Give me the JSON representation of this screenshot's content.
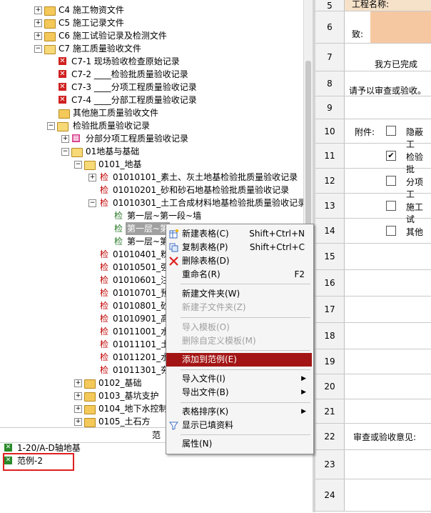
{
  "tree": [
    {
      "text": "C4 施工物资文件"
    },
    {
      "text": "C5 施工记录文件"
    },
    {
      "text": "C6 施工试验记录及检测文件"
    },
    {
      "text": "C7 施工质量验收文件"
    },
    {
      "text": "C7-1 现场验收检查原始记录"
    },
    {
      "text": "C7-2 ____检验批质量验收记录"
    },
    {
      "text": "C7-3 ____分项工程质量验收记录"
    },
    {
      "text": "C7-4 ____分部工程质量验收记录"
    },
    {
      "text": "其他施工质量验收文件"
    },
    {
      "text": "检验批质量验收记录"
    },
    {
      "text": "分部分项工程质量验收记录"
    },
    {
      "text": "01地基与基础"
    },
    {
      "text": "0101_地基"
    },
    {
      "text": "01010101_素土、灰土地基检验批质量验收记录"
    },
    {
      "text": "01010201_砂和砂石地基检验批质量验收记录"
    },
    {
      "text": "01010301_土工合成材料地基检验批质量验收记录"
    },
    {
      "text": "第一层~第一段~墙"
    },
    {
      "text": "第一层~第"
    },
    {
      "text": "第一层~第"
    },
    {
      "text": "01010401_粉煤"
    },
    {
      "text": "01010501_强夯"
    },
    {
      "text": "01010601_注浆"
    },
    {
      "text": "01010701_预压"
    },
    {
      "text": "01010801_砂石"
    },
    {
      "text": "01010901_高压"
    },
    {
      "text": "01011001_水泥"
    },
    {
      "text": "01011101_土和"
    },
    {
      "text": "01011201_水泥"
    },
    {
      "text": "01011301_夯实"
    },
    {
      "text": "0102_基础"
    },
    {
      "text": "0103_基坑支护"
    },
    {
      "text": "0104_地下水控制"
    },
    {
      "text": "0105_土石方"
    }
  ],
  "jian": "检",
  "lower": {
    "header": "范",
    "items": [
      {
        "text": "1-20/A-D轴地基"
      },
      {
        "text": "范例-2"
      }
    ]
  },
  "menu": [
    {
      "label": "新建表格(C)",
      "key": "Shift+Ctrl+N",
      "icon": "new-table-icon"
    },
    {
      "label": "复制表格(P)",
      "key": "Shift+Ctrl+C",
      "icon": "copy-table-icon"
    },
    {
      "label": "删除表格(D)",
      "key": "",
      "icon": "delete-icon"
    },
    {
      "label": "重命名(R)",
      "key": "F2"
    },
    {
      "label": "新建文件夹(W)"
    },
    {
      "label": "新建子文件夹(Z)"
    },
    {
      "label": "导入模板(O)"
    },
    {
      "label": "删除自定义模板(M)"
    },
    {
      "label": "添加到范例(E)"
    },
    {
      "label": "导入文件(I)",
      "arrow": "▶"
    },
    {
      "label": "导出文件(B)",
      "arrow": "▶"
    },
    {
      "label": "表格排序(K)",
      "arrow": "▶"
    },
    {
      "label": "显示已填资料",
      "icon": "filter-icon"
    },
    {
      "label": "属性(N)"
    }
  ],
  "sheet": {
    "rows": [
      "5",
      "6",
      "7",
      "8",
      "9",
      "10",
      "11",
      "12",
      "13",
      "14",
      "15",
      "16",
      "17",
      "18",
      "19",
      "20",
      "21",
      "22",
      "23",
      "24"
    ],
    "project_name_label": "工程名称:",
    "zhi": "致:",
    "completed": "我方已完成",
    "request": "请予以审查或验收。",
    "attachment": "附件:",
    "items": [
      "隐蔽工",
      "检验批",
      "分项工",
      "施工试",
      "其他"
    ],
    "opinion": "审查或验收意见:"
  }
}
